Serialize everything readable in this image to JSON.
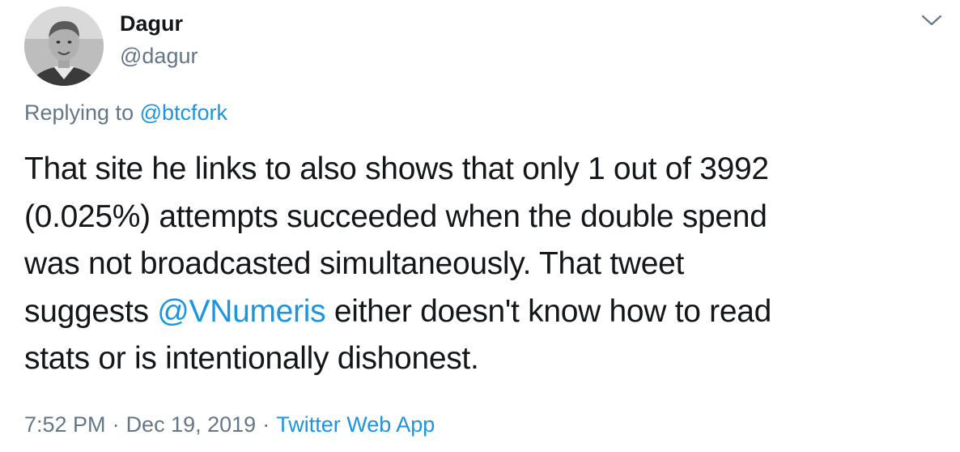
{
  "author": {
    "display_name": "Dagur",
    "handle": "@dagur",
    "avatar_icon": "user-avatar-photo"
  },
  "menu": {
    "caret_icon": "chevron-down-icon"
  },
  "reply": {
    "prefix": "Replying to",
    "mention": "@btcfork"
  },
  "body": {
    "line1": "That site he links to also shows that only 1 out of 3992",
    "line2": "(0.025%) attempts succeeded when the double spend",
    "line3": "was not broadcasted simultaneously. That tweet",
    "line4_before": "suggests ",
    "line4_mention": "@VNumeris",
    "line4_after": " either doesn't know how to read",
    "line5": "stats or is intentionally dishonest."
  },
  "meta": {
    "time": "7:52 PM",
    "separator": "·",
    "date": "Dec 19, 2019",
    "source": "Twitter Web App"
  },
  "colors": {
    "text": "#14171a",
    "secondary": "#657786",
    "link": "#1b95e0"
  }
}
